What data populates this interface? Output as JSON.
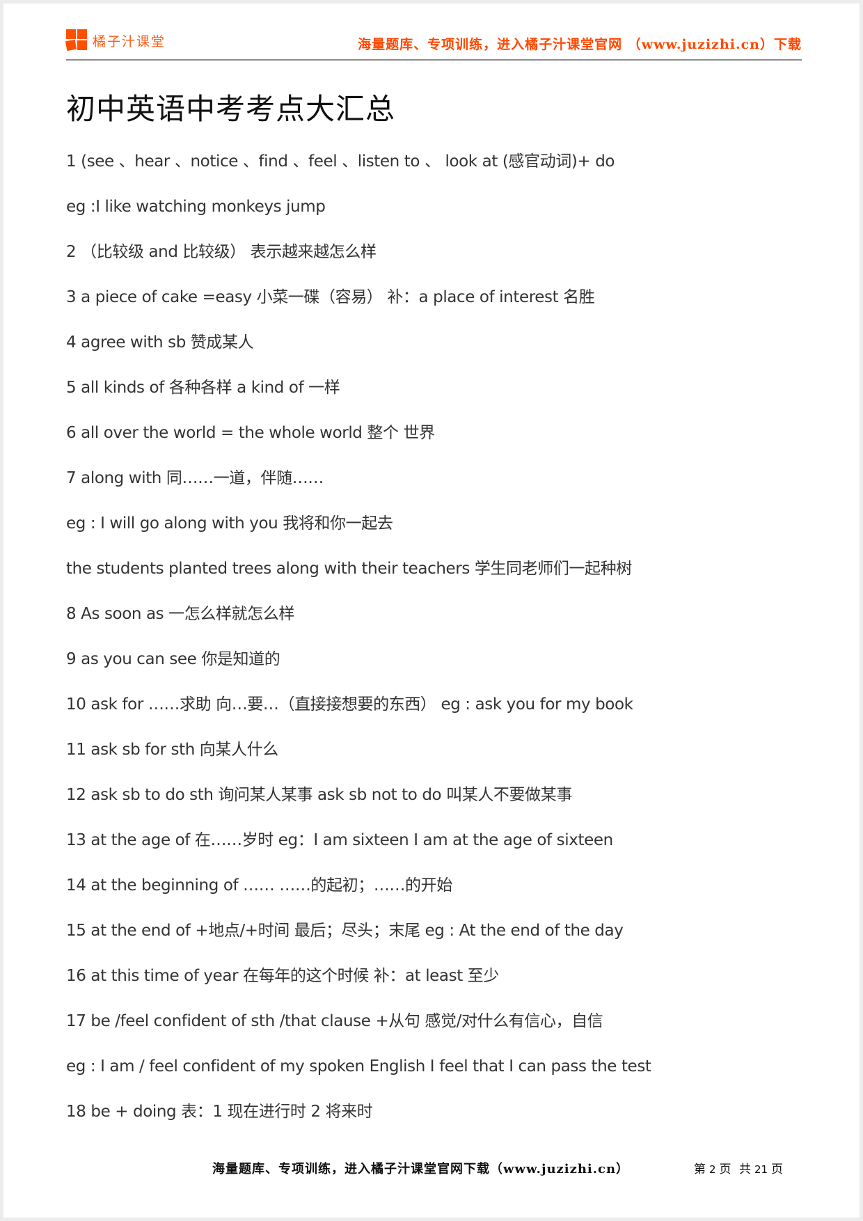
{
  "header": {
    "brand_name": "橘子汁课堂",
    "slogan": "海量题库、专项训练，进入橘子汁课堂官网 （www.juzizhi.cn）下载",
    "brand_color": "#ff5000"
  },
  "document": {
    "title": "初中英语中考考点大汇总",
    "lines": [
      "1 (see 、hear 、notice 、find 、feel 、listen to 、  look at (感官动词)+ do",
      "eg :I like watching monkeys jump",
      "2  （比较级 and 比较级） 表示越来越怎么样",
      "3 a piece of cake =easy 小菜一碟（容易） 补：a place of interest 名胜",
      "4 agree with sb 赞成某人",
      "5 all kinds of 各种各样 a kind of 一样",
      "6 all over the world = the whole world 整个 世界",
      "7 along with 同……一道，伴随……",
      "eg : I will go along with you 我将和你一起去",
      "the students planted trees along with their teachers 学生同老师们一起种树",
      "8 As soon as 一怎么样就怎么样",
      "9 as you can see 你是知道的",
      "10 ask for ……求助 向…要…（直接接想要的东西） eg : ask you for my book",
      "11 ask sb for sth 向某人什么",
      "12 ask sb to do sth 询问某人某事 ask sb not to do 叫某人不要做某事",
      "13 at the age of 在……岁时 eg：I am sixteen I am at the age of sixteen",
      "14 at the beginning of …… ……的起初；……的开始",
      "15 at the end of +地点/+时间 最后；尽头；末尾 eg : At the end of the day",
      "16 at this time of year 在每年的这个时候 补：at least 至少",
      "17 be /feel confident of sth /that clause +从句 感觉/对什么有信心，自信",
      "eg : I am / feel confident of my spoken English I feel that I can pass the test",
      "18 be + doing 表：1 现在进行时 2 将来时"
    ]
  },
  "footer": {
    "slogan": "海量题库、专项训练，进入橘子汁课堂官网下载（www.juzizhi.cn）",
    "page_prefix": "第",
    "current_page": "2",
    "page_mid": "页 共",
    "total_pages": "21",
    "page_suffix": "页"
  }
}
